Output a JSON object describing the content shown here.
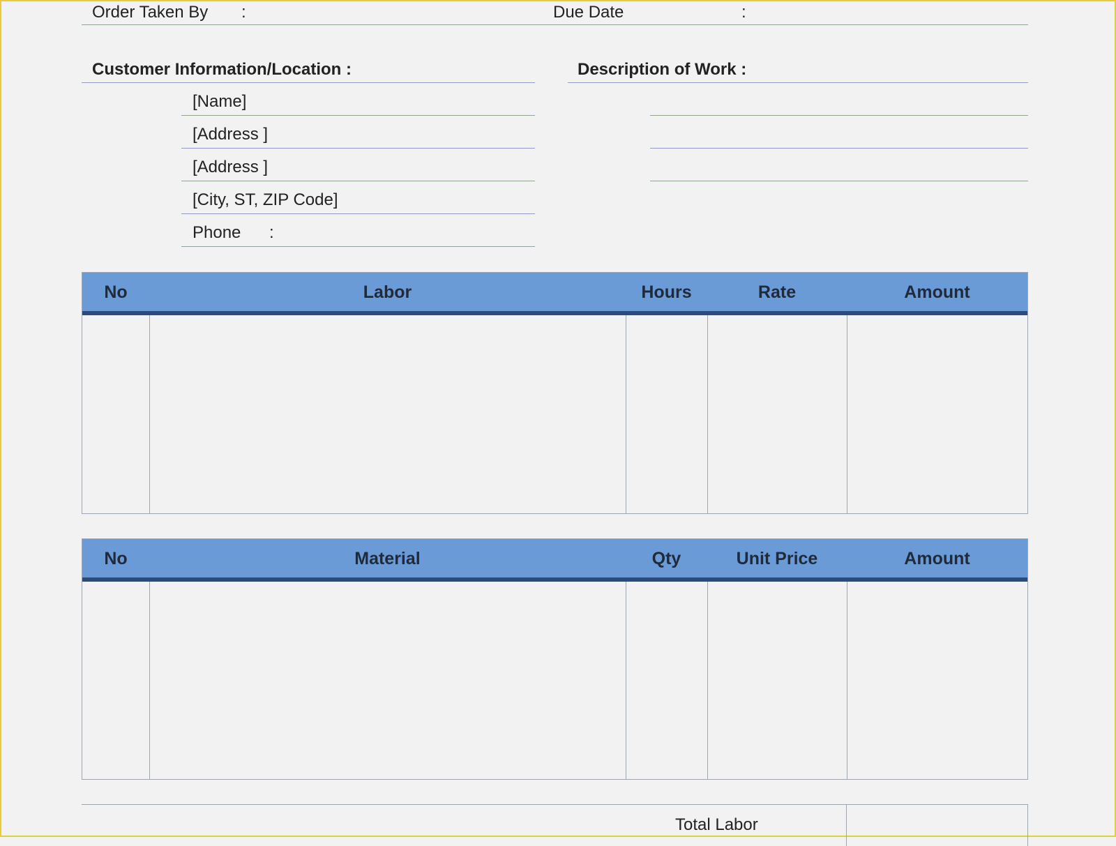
{
  "header": {
    "order_taken_by_label": "Order Taken By",
    "order_taken_by_colon": ":",
    "due_date_label": "Due Date",
    "due_date_colon": ":"
  },
  "customer": {
    "section_title": "Customer  Information/Location :",
    "name": "[Name]",
    "address1": "[Address ]",
    "address2": "[Address ]",
    "city": "[City, ST, ZIP Code]",
    "phone_label": "Phone",
    "phone_colon": ":"
  },
  "description": {
    "section_title": "Description of Work :"
  },
  "labor_table": {
    "headers": [
      "No",
      "Labor",
      "Hours",
      "Rate",
      "Amount"
    ]
  },
  "material_table": {
    "headers": [
      "No",
      "Material",
      "Qty",
      "Unit Price",
      "Amount"
    ]
  },
  "totals": {
    "total_labor_label": "Total Labor"
  },
  "colors": {
    "header_fill": "#6b9bd6",
    "header_underline": "#2e4a7a",
    "rule_lines": "#8aa0c0",
    "page_border": "#e3cf3a"
  }
}
